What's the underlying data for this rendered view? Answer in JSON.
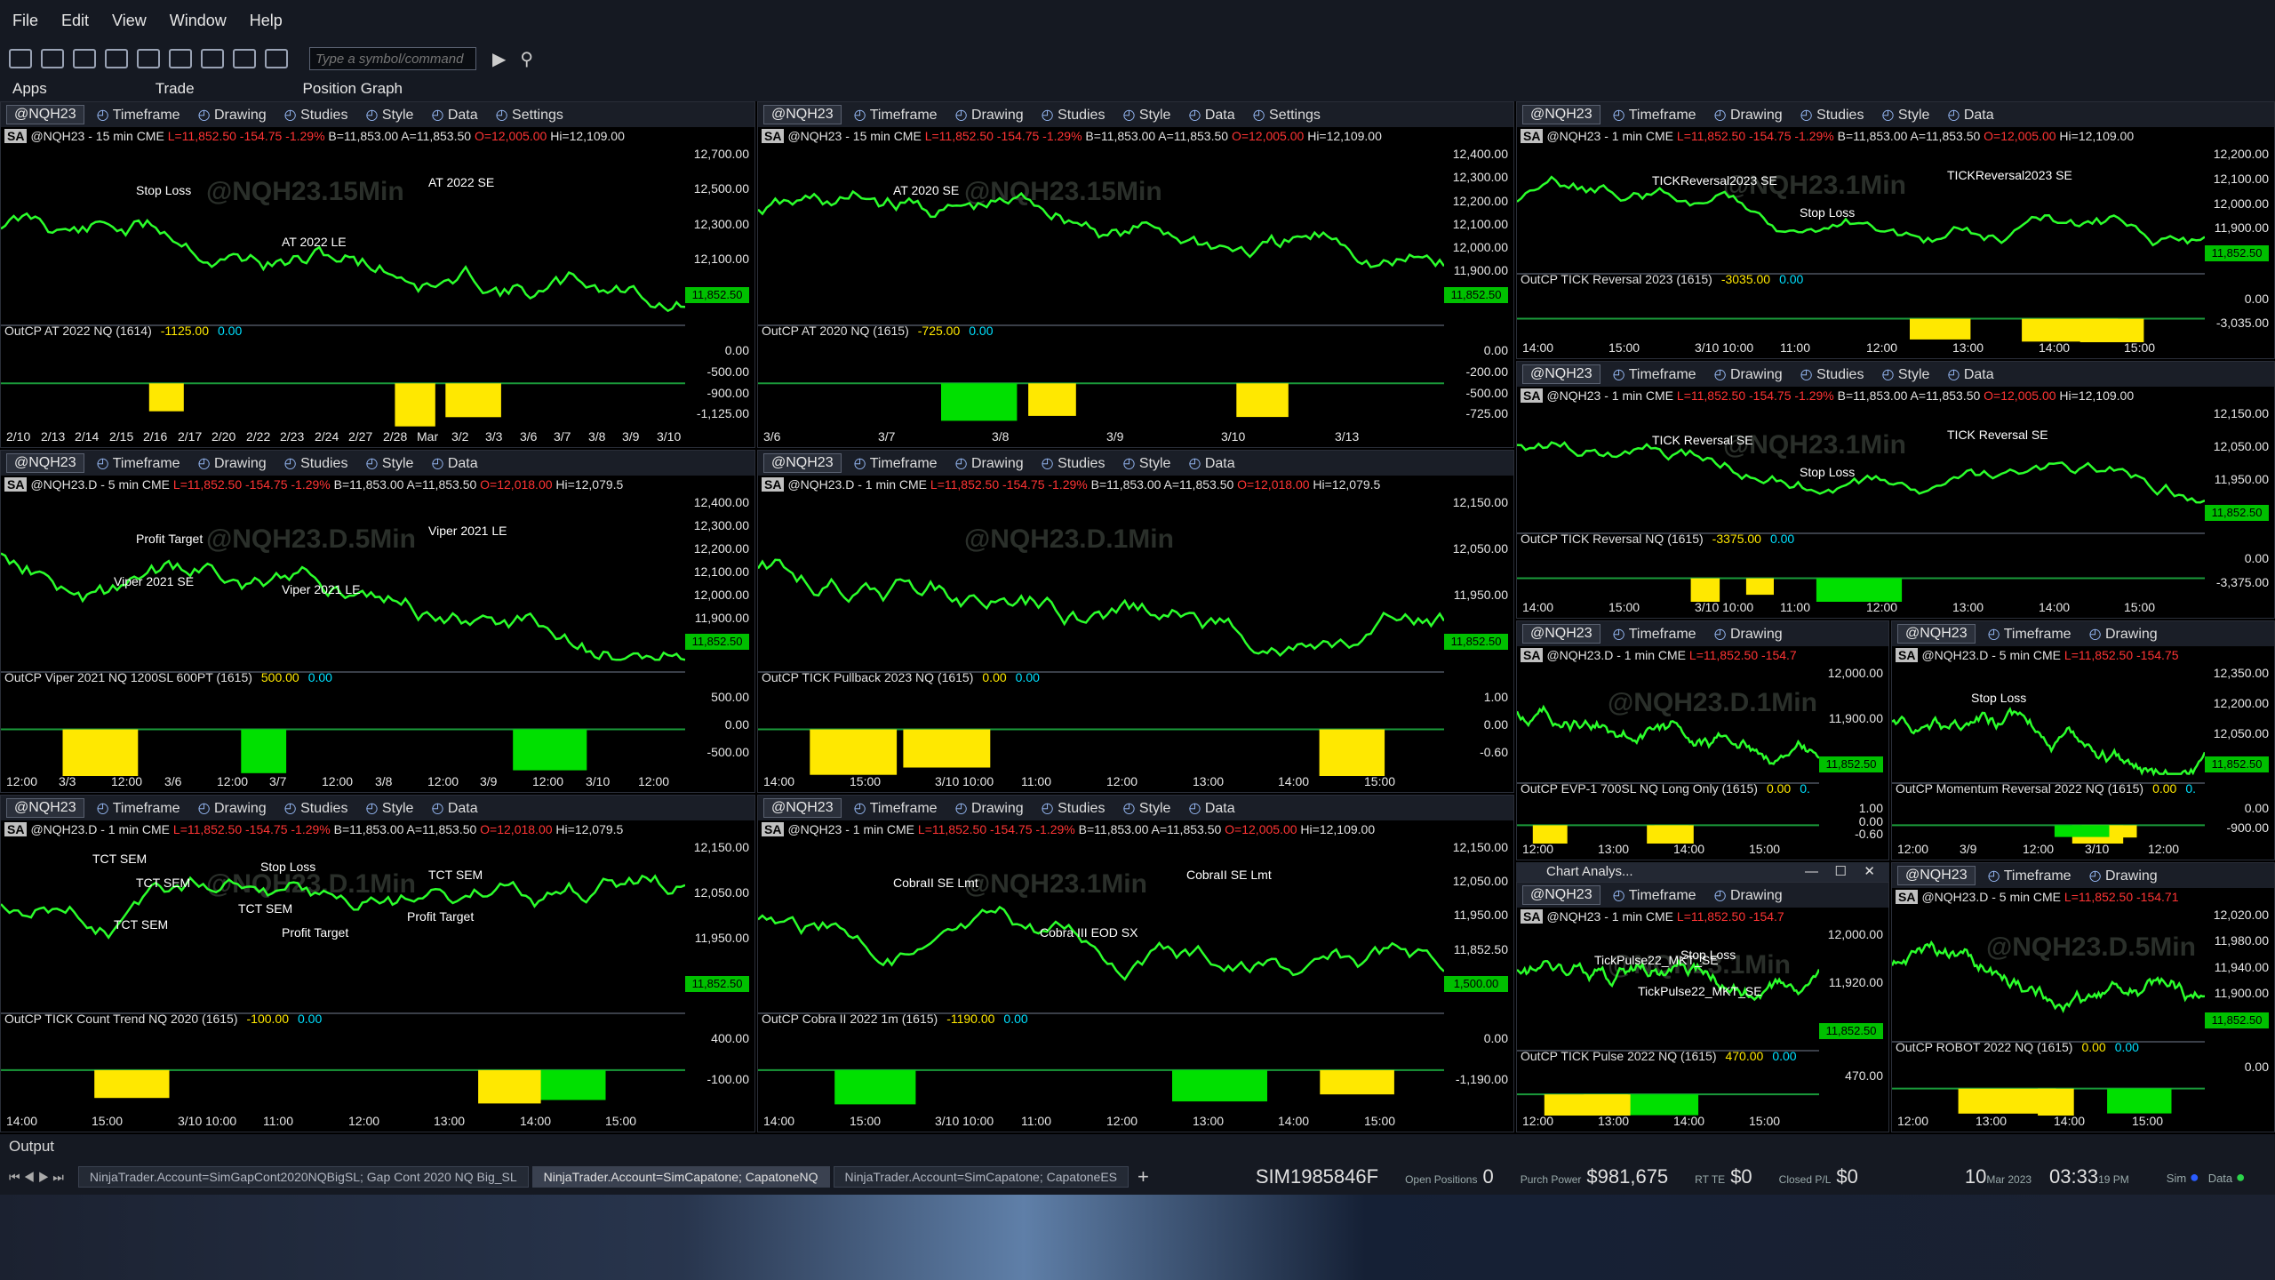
{
  "menu": [
    "File",
    "Edit",
    "View",
    "Window",
    "Help"
  ],
  "toolbar": {
    "symbol_placeholder": "Type a symbol/command"
  },
  "tabs": [
    "Apps",
    "Trade",
    "Position Graph"
  ],
  "panel_toolbar": {
    "symbol": "@NQH23",
    "timeframe": "Timeframe",
    "drawing": "Drawing",
    "studies": "Studies",
    "style": "Style",
    "data": "Data",
    "settings": "Settings"
  },
  "panels": [
    {
      "info": "@NQH23 - 15 min  CME",
      "last": "L=11,852.50  -154.75  -1.29%",
      "bid": "B=11,853.00  A=11,853.50",
      "open": "O=12,005.00",
      "high": "Hi=12,109.00",
      "yaxis": [
        "12,700.00",
        "12,500.00",
        "12,300.00",
        "12,100.00",
        "11,852.50"
      ],
      "indicator": "OutCP AT 2022 NQ (1614)",
      "ind_val": "-1125.00",
      "ind_val2": "0.00",
      "ind_axis": [
        "0.00",
        "-500.00",
        "-900.00",
        "-1,125.00"
      ],
      "xaxis": [
        "2/10",
        "2/13",
        "2/14",
        "2/15",
        "2/16",
        "2/17",
        "2/20",
        "2/22",
        "2/23",
        "2/24",
        "2/27",
        "2/28",
        "Mar",
        "3/2",
        "3/3",
        "3/6",
        "3/7",
        "3/8",
        "3/9",
        "3/10"
      ],
      "ann": [
        "Stop Loss",
        "AT 2022 LE",
        "AT 2022 SE"
      ],
      "watermark": "@NQH23.15Min"
    },
    {
      "info": "@NQH23 - 15 min  CME",
      "last": "L=11,852.50  -154.75  -1.29%",
      "bid": "B=11,853.00  A=11,853.50",
      "open": "O=12,005.00",
      "high": "Hi=12,109.00",
      "yaxis": [
        "12,400.00",
        "12,300.00",
        "12,200.00",
        "12,100.00",
        "12,000.00",
        "11,900.00",
        "11,852.50"
      ],
      "indicator": "OutCP AT 2020 NQ (1615)",
      "ind_val": "-725.00",
      "ind_val2": "0.00",
      "ind_axis": [
        "0.00",
        "-200.00",
        "-500.00",
        "-725.00"
      ],
      "xaxis": [
        "3/6",
        "3/7",
        "3/8",
        "3/9",
        "3/10",
        "3/13"
      ],
      "ann": [
        "AT 2020 SE"
      ],
      "watermark": "@NQH23.15Min"
    },
    {
      "info": "@NQH23 - 1 min  CME",
      "last": "L=11,852.50  -154.75  -1.29%",
      "bid": "B=11,853.00  A=11,853.50",
      "open": "O=12,005.00",
      "high": "Hi=12,109.00",
      "yaxis": [
        "12,200.00",
        "12,100.00",
        "12,000.00",
        "11,900.00",
        "11,852.50"
      ],
      "indicator": "OutCP TICK Reversal 2023 (1615)",
      "ind_val": "-3035.00",
      "ind_val2": "0.00",
      "ind_axis": [
        "0.00",
        "-3,035.00"
      ],
      "xaxis": [
        "14:00",
        "15:00",
        "3/10 10:00",
        "11:00",
        "12:00",
        "13:00",
        "14:00",
        "15:00"
      ],
      "ann": [
        "TICKReversal2023 SE",
        "Stop Loss",
        "TICKReversal2023 SE"
      ],
      "watermark": "@NQH23.1Min"
    },
    {
      "info": "@NQH23.D - 5 min  CME",
      "last": "L=11,852.50  -154.75  -1.29%",
      "bid": "B=11,853.00  A=11,853.50",
      "open": "O=12,018.00",
      "high": "Hi=12,079.5",
      "yaxis": [
        "12,400.00",
        "12,300.00",
        "12,200.00",
        "12,100.00",
        "12,000.00",
        "11,900.00",
        "11,852.50"
      ],
      "indicator": "OutCP Viper 2021 NQ 1200SL 600PT (1615)",
      "ind_val": "500.00",
      "ind_val2": "0.00",
      "ind_axis": [
        "500.00",
        "0.00",
        "-500.00"
      ],
      "xaxis": [
        "12:00",
        "3/3",
        "12:00",
        "3/6",
        "12:00",
        "3/7",
        "12:00",
        "3/8",
        "12:00",
        "3/9",
        "12:00",
        "3/10",
        "12:00"
      ],
      "ann": [
        "Profit Target",
        "Viper 2021 LE",
        "Viper 2021 LE",
        "Viper 2021 SE"
      ],
      "watermark": "@NQH23.D.5Min"
    },
    {
      "info": "@NQH23.D - 1 min  CME",
      "last": "L=11,852.50  -154.75  -1.29%",
      "bid": "B=11,853.00  A=11,853.50",
      "open": "O=12,018.00",
      "high": "Hi=12,079.5",
      "yaxis": [
        "12,150.00",
        "12,050.00",
        "11,950.00",
        "11,852.50"
      ],
      "indicator": "OutCP TICK Pullback 2023 NQ (1615)",
      "ind_val": "0.00",
      "ind_val2": "0.00",
      "ind_axis": [
        "1.00",
        "0.00",
        "-0.60"
      ],
      "xaxis": [
        "14:00",
        "15:00",
        "3/10 10:00",
        "11:00",
        "12:00",
        "13:00",
        "14:00",
        "15:00"
      ],
      "ann": [],
      "watermark": "@NQH23.D.1Min"
    },
    {
      "info": "@NQH23 - 1 min  CME",
      "last": "L=11,852.50  -154.75  -1.29%",
      "bid": "B=11,853.00  A=11,853.50",
      "open": "O=12,005.00",
      "high": "Hi=12,109.00",
      "yaxis": [
        "12,150.00",
        "12,050.00",
        "11,950.00",
        "11,852.50"
      ],
      "indicator": "OutCP TICK Reversal NQ (1615)",
      "ind_val": "-3375.00",
      "ind_val2": "0.00",
      "ind_axis": [
        "0.00",
        "-3,375.00"
      ],
      "xaxis": [
        "14:00",
        "15:00",
        "3/10 10:00",
        "11:00",
        "12:00",
        "13:00",
        "14:00",
        "15:00"
      ],
      "ann": [
        "TICK Reversal SE",
        "Stop Loss",
        "TICK Reversal SE"
      ],
      "watermark": "@NQH23.1Min"
    },
    {
      "info": "@NQH23.D - 1 min  CME",
      "last": "L=11,852.50  -154.7",
      "bid": "",
      "open": "",
      "high": "",
      "yaxis": [
        "12,000.00",
        "11,900.00",
        "11,852.50"
      ],
      "indicator": "OutCP EVP-1 700SL NQ Long Only (1615)",
      "ind_val": "0.00",
      "ind_val2": "0.",
      "ind_axis": [
        "1.00",
        "0.00",
        "-0.60"
      ],
      "xaxis": [
        "12:00",
        "13:00",
        "14:00",
        "15:00"
      ],
      "ann": [],
      "watermark": "@NQH23.D.1Min"
    },
    {
      "info": "@NQH23.D - 5 min  CME",
      "last": "L=11,852.50  -154.75",
      "bid": "",
      "open": "",
      "high": "",
      "yaxis": [
        "12,350.00",
        "12,200.00",
        "12,050.00",
        "11,852.50"
      ],
      "indicator": "OutCP Momentum Reversal 2022 NQ (1615)",
      "ind_val": "0.00",
      "ind_val2": "0.",
      "ind_axis": [
        "0.00",
        "-900.00"
      ],
      "xaxis": [
        "12:00",
        "3/9",
        "12:00",
        "3/10",
        "12:00"
      ],
      "ann": [
        "Stop Loss"
      ],
      "watermark": ""
    },
    {
      "info": "@NQH23.D - 1 min  CME",
      "last": "L=11,852.50  -154.75  -1.29%",
      "bid": "B=11,853.00  A=11,853.50",
      "open": "O=12,018.00",
      "high": "Hi=12,079.5",
      "yaxis": [
        "12,150.00",
        "12,050.00",
        "11,950.00",
        "11,852.50"
      ],
      "indicator": "OutCP TICK Count Trend NQ 2020 (1615)",
      "ind_val": "-100.00",
      "ind_val2": "0.00",
      "ind_axis": [
        "400.00",
        "-100.00"
      ],
      "xaxis": [
        "14:00",
        "15:00",
        "3/10 10:00",
        "11:00",
        "12:00",
        "13:00",
        "14:00",
        "15:00"
      ],
      "ann": [
        "TCT SEM",
        "Profit Target",
        "TCT SEM",
        "TCT SEM",
        "Stop Loss",
        "Profit Target",
        "TCT SEM",
        "TCT SEM"
      ],
      "watermark": "@NQH23.D.1Min"
    },
    {
      "info": "@NQH23 - 1 min  CME",
      "last": "L=11,852.50  -154.75  -1.29%",
      "bid": "B=11,853.00  A=11,853.50",
      "open": "O=12,005.00",
      "high": "Hi=12,109.00",
      "yaxis": [
        "12,150.00",
        "12,050.00",
        "11,950.00",
        "11,852.50",
        "1,500.00"
      ],
      "indicator": "OutCP Cobra II 2022 1m (1615)",
      "ind_val": "-1190.00",
      "ind_val2": "0.00",
      "ind_axis": [
        "0.00",
        "-1,190.00"
      ],
      "xaxis": [
        "14:00",
        "15:00",
        "3/10 10:00",
        "11:00",
        "12:00",
        "13:00",
        "14:00",
        "15:00"
      ],
      "ann": [
        "CobraII SE Lmt",
        "Cobra III EOD SX",
        "CobraII SE Lmt"
      ],
      "watermark": "@NQH23.1Min"
    },
    {
      "info": "@NQH23 - 1 min  CME",
      "last": "L=11,852.50  -154.7",
      "bid": "",
      "open": "",
      "high": "",
      "yaxis": [
        "12,000.00",
        "11,920.00",
        "11,852.50"
      ],
      "indicator": "OutCP TICK Pulse 2022 NQ (1615)",
      "ind_val": "470.00",
      "ind_val2": "0.00",
      "ind_axis": [
        "470.00"
      ],
      "xaxis": [
        "12:00",
        "13:00",
        "14:00",
        "15:00"
      ],
      "ann": [
        "TickPulse22_MKT_SE",
        "TickPulse22_MKT_SE",
        "Stop Loss"
      ],
      "watermark": "@NQH23.1Min"
    },
    {
      "info": "@NQH23.D - 5 min  CME",
      "last": "L=11,852.50  -154.71",
      "bid": "",
      "open": "",
      "high": "",
      "yaxis": [
        "12,020.00",
        "11,980.00",
        "11,940.00",
        "11,900.00",
        "11,852.50"
      ],
      "indicator": "OutCP ROBOT 2022 NQ (1615)",
      "ind_val": "0.00",
      "ind_val2": "0.00",
      "ind_axis": [
        "0.00"
      ],
      "xaxis": [
        "12:00",
        "13:00",
        "14:00",
        "15:00"
      ],
      "ann": [],
      "watermark": "@NQH23.D.5Min"
    }
  ],
  "chart_analysis": {
    "title": "Chart Analys..."
  },
  "output": {
    "label": "Output"
  },
  "accounts": [
    "NinjaTrader.Account=SimGapCont2020NQBigSL; Gap Cont 2020 NQ Big_SL",
    "NinjaTrader.Account=SimCapatone; CapatoneNQ",
    "NinjaTrader.Account=SimCapatone; CapatoneES"
  ],
  "status": {
    "account_id": "SIM1985846F",
    "open_positions_label": "Open Positions",
    "open_positions": "0",
    "purch_power_label": "Purch Power",
    "purch_power": "$981,675",
    "rt_label": "RT TE",
    "rt": "$0",
    "closed_pl_label": "Closed P/L",
    "closed_pl": "$0",
    "date_day": "10",
    "date_month": "Mar 2023",
    "time": "03:33",
    "time_suffix": "19 PM",
    "sim_label": "Sim",
    "data_label": "Data"
  }
}
